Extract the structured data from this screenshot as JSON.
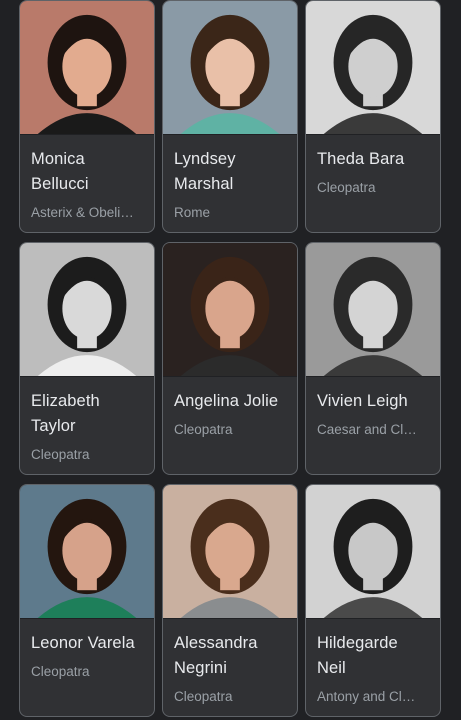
{
  "cards": [
    {
      "name": "Monica Bellucci",
      "sub": "Asterix & Obeli…",
      "photo": "monica-bellucci-photo",
      "bg": "#b97a6a",
      "hair": "#1e1410",
      "skin": "#e2ab8f",
      "top": "#1a1a1a"
    },
    {
      "name": "Lyndsey Marshal",
      "sub": "Rome",
      "photo": "lyndsey-marshal-photo",
      "bg": "#8a9aa6",
      "hair": "#3b2618",
      "skin": "#e9c0a8",
      "top": "#5fb2a4"
    },
    {
      "name": "Theda Bara",
      "sub": "Cleopatra",
      "photo": "theda-bara-photo",
      "bg": "#d8d8d8",
      "hair": "#262626",
      "skin": "#cfcfcf",
      "top": "#3a3a3a"
    },
    {
      "name": "Elizabeth Taylor",
      "sub": "Cleopatra",
      "photo": "elizabeth-taylor-photo",
      "bg": "#bdbdbd",
      "hair": "#1c1c1c",
      "skin": "#d9d9d9",
      "top": "#eeeeee"
    },
    {
      "name": "Angelina Jolie",
      "sub": "Cleopatra",
      "photo": "angelina-jolie-photo",
      "bg": "#2a2220",
      "hair": "#3a2418",
      "skin": "#d9a58c",
      "top": "#2b2b2b"
    },
    {
      "name": "Vivien Leigh",
      "sub": "Caesar and Cl…",
      "photo": "vivien-leigh-photo",
      "bg": "#9a9a9a",
      "hair": "#2a2a2a",
      "skin": "#d4d4d4",
      "top": "#3a3a3a"
    },
    {
      "name": "Leonor Varela",
      "sub": "Cleopatra",
      "photo": "leonor-varela-photo",
      "bg": "#5e7a8c",
      "hair": "#24160f",
      "skin": "#d6a28a",
      "top": "#1e7f5a"
    },
    {
      "name": "Alessandra Negrini",
      "sub": "Cleopatra",
      "photo": "alessandra-negrini-photo",
      "bg": "#c9b0a0",
      "hair": "#4a2e1c",
      "skin": "#d9a88e",
      "top": "#8a8d8f"
    },
    {
      "name": "Hildegarde Neil",
      "sub": "Antony and Cl…",
      "photo": "hildegarde-neil-photo",
      "bg": "#d2d2d2",
      "hair": "#1e1e1e",
      "skin": "#c8c8c8",
      "top": "#4a4a4a"
    }
  ]
}
